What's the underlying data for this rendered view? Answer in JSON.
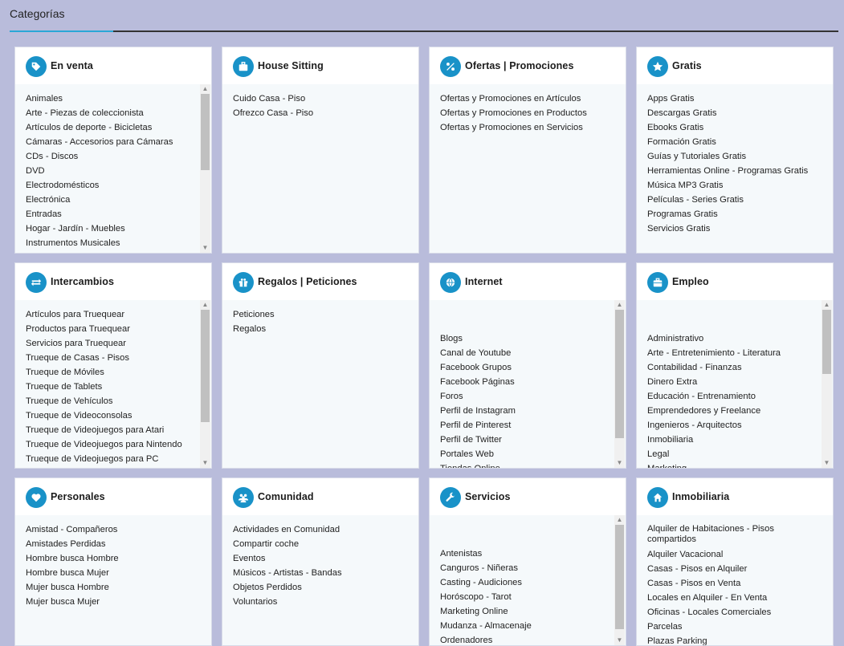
{
  "page": {
    "title": "Categorías"
  },
  "colors": {
    "accent": "#1992c8",
    "background": "#b9bcdb",
    "underline": "#2aa7d6"
  },
  "cards": [
    {
      "title": "En venta",
      "icon": "tag-icon",
      "items": [
        "Animales",
        "Arte - Piezas de coleccionista",
        "Artículos de deporte - Bicicletas",
        "Cámaras - Accesorios para Cámaras",
        "CDs - Discos",
        "DVD",
        "Electrodomésticos",
        "Electrónica",
        "Entradas",
        "Hogar - Jardín - Muebles",
        "Instrumentos Musicales"
      ]
    },
    {
      "title": "House Sitting",
      "icon": "briefcase-icon",
      "items": [
        "Cuido Casa - Piso",
        "Ofrezco Casa - Piso"
      ]
    },
    {
      "title": "Ofertas | Promociones",
      "icon": "percent-icon",
      "items": [
        "Ofertas y Promociones en Artículos",
        "Ofertas y Promociones en Productos",
        "Ofertas y Promociones en Servicios"
      ]
    },
    {
      "title": "Gratis",
      "icon": "star-icon",
      "items": [
        "Apps Gratis",
        "Descargas Gratis",
        "Ebooks Gratis",
        "Formación Gratis",
        "Guías y Tutoriales Gratis",
        "Herramientas Online - Programas Gratis",
        "Música MP3 Gratis",
        "Películas - Series Gratis",
        "Programas Gratis",
        "Servicios Gratis"
      ]
    },
    {
      "title": "Intercambios",
      "icon": "exchange-icon",
      "items": [
        "Artículos para Truequear",
        "Productos para Truequear",
        "Servicios para Truequear",
        "Trueque de Casas - Pisos",
        "Trueque de Móviles",
        "Trueque de Tablets",
        "Trueque de Vehículos",
        "Trueque de Videoconsolas",
        "Trueque de Videojuegos para Atari",
        "Trueque de Videojuegos para Nintendo",
        "Trueque de Videojuegos para PC"
      ]
    },
    {
      "title": "Regalos | Peticiones",
      "icon": "gift-icon",
      "items": [
        "Peticiones",
        "Regalos"
      ]
    },
    {
      "title": "Internet",
      "icon": "globe-icon",
      "items": [
        "Blogs",
        "Canal de Youtube",
        "Facebook Grupos",
        "Facebook Páginas",
        "Foros",
        "Perfil de Instagram",
        "Perfil de Pinterest",
        "Perfil de Twitter",
        "Portales Web",
        "Tiendas Online"
      ]
    },
    {
      "title": "Empleo",
      "icon": "suitcase-icon",
      "items": [
        "Administrativo",
        "Arte - Entretenimiento - Literatura",
        "Contabilidad - Finanzas",
        "Dinero Extra",
        "Educación - Entrenamiento",
        "Emprendedores y Freelance",
        "Ingenieros - Arquitectos",
        "Inmobiliaria",
        "Legal",
        "Marketing"
      ]
    },
    {
      "title": "Personales",
      "icon": "heart-icon",
      "items": [
        "Amistad - Compañeros",
        "Amistades Perdidas",
        "Hombre busca Hombre",
        "Hombre busca Mujer",
        "Mujer busca Hombre",
        "Mujer busca Mujer"
      ]
    },
    {
      "title": "Comunidad",
      "icon": "users-icon",
      "items": [
        "Actividades en Comunidad",
        "Compartir coche",
        "Eventos",
        "Músicos - Artistas - Bandas",
        "Objetos Perdidos",
        "Voluntarios"
      ]
    },
    {
      "title": "Servicios",
      "icon": "wrench-icon",
      "items": [
        "Antenistas",
        "Canguros - Niñeras",
        "Casting - Audiciones",
        "Horóscopo - Tarot",
        "Marketing Online",
        "Mudanza - Almacenaje",
        "Ordenadores"
      ]
    },
    {
      "title": "Inmobiliaria",
      "icon": "home-icon",
      "items": [
        "Alquiler de Habitaciones - Pisos compartidos",
        "Alquiler Vacacional",
        "Casas - Pisos en Alquiler",
        "Casas - Pisos en Venta",
        "Locales en Alquiler - En Venta",
        "Oficinas - Locales Comerciales",
        "Parcelas",
        "Plazas Parking"
      ]
    }
  ]
}
